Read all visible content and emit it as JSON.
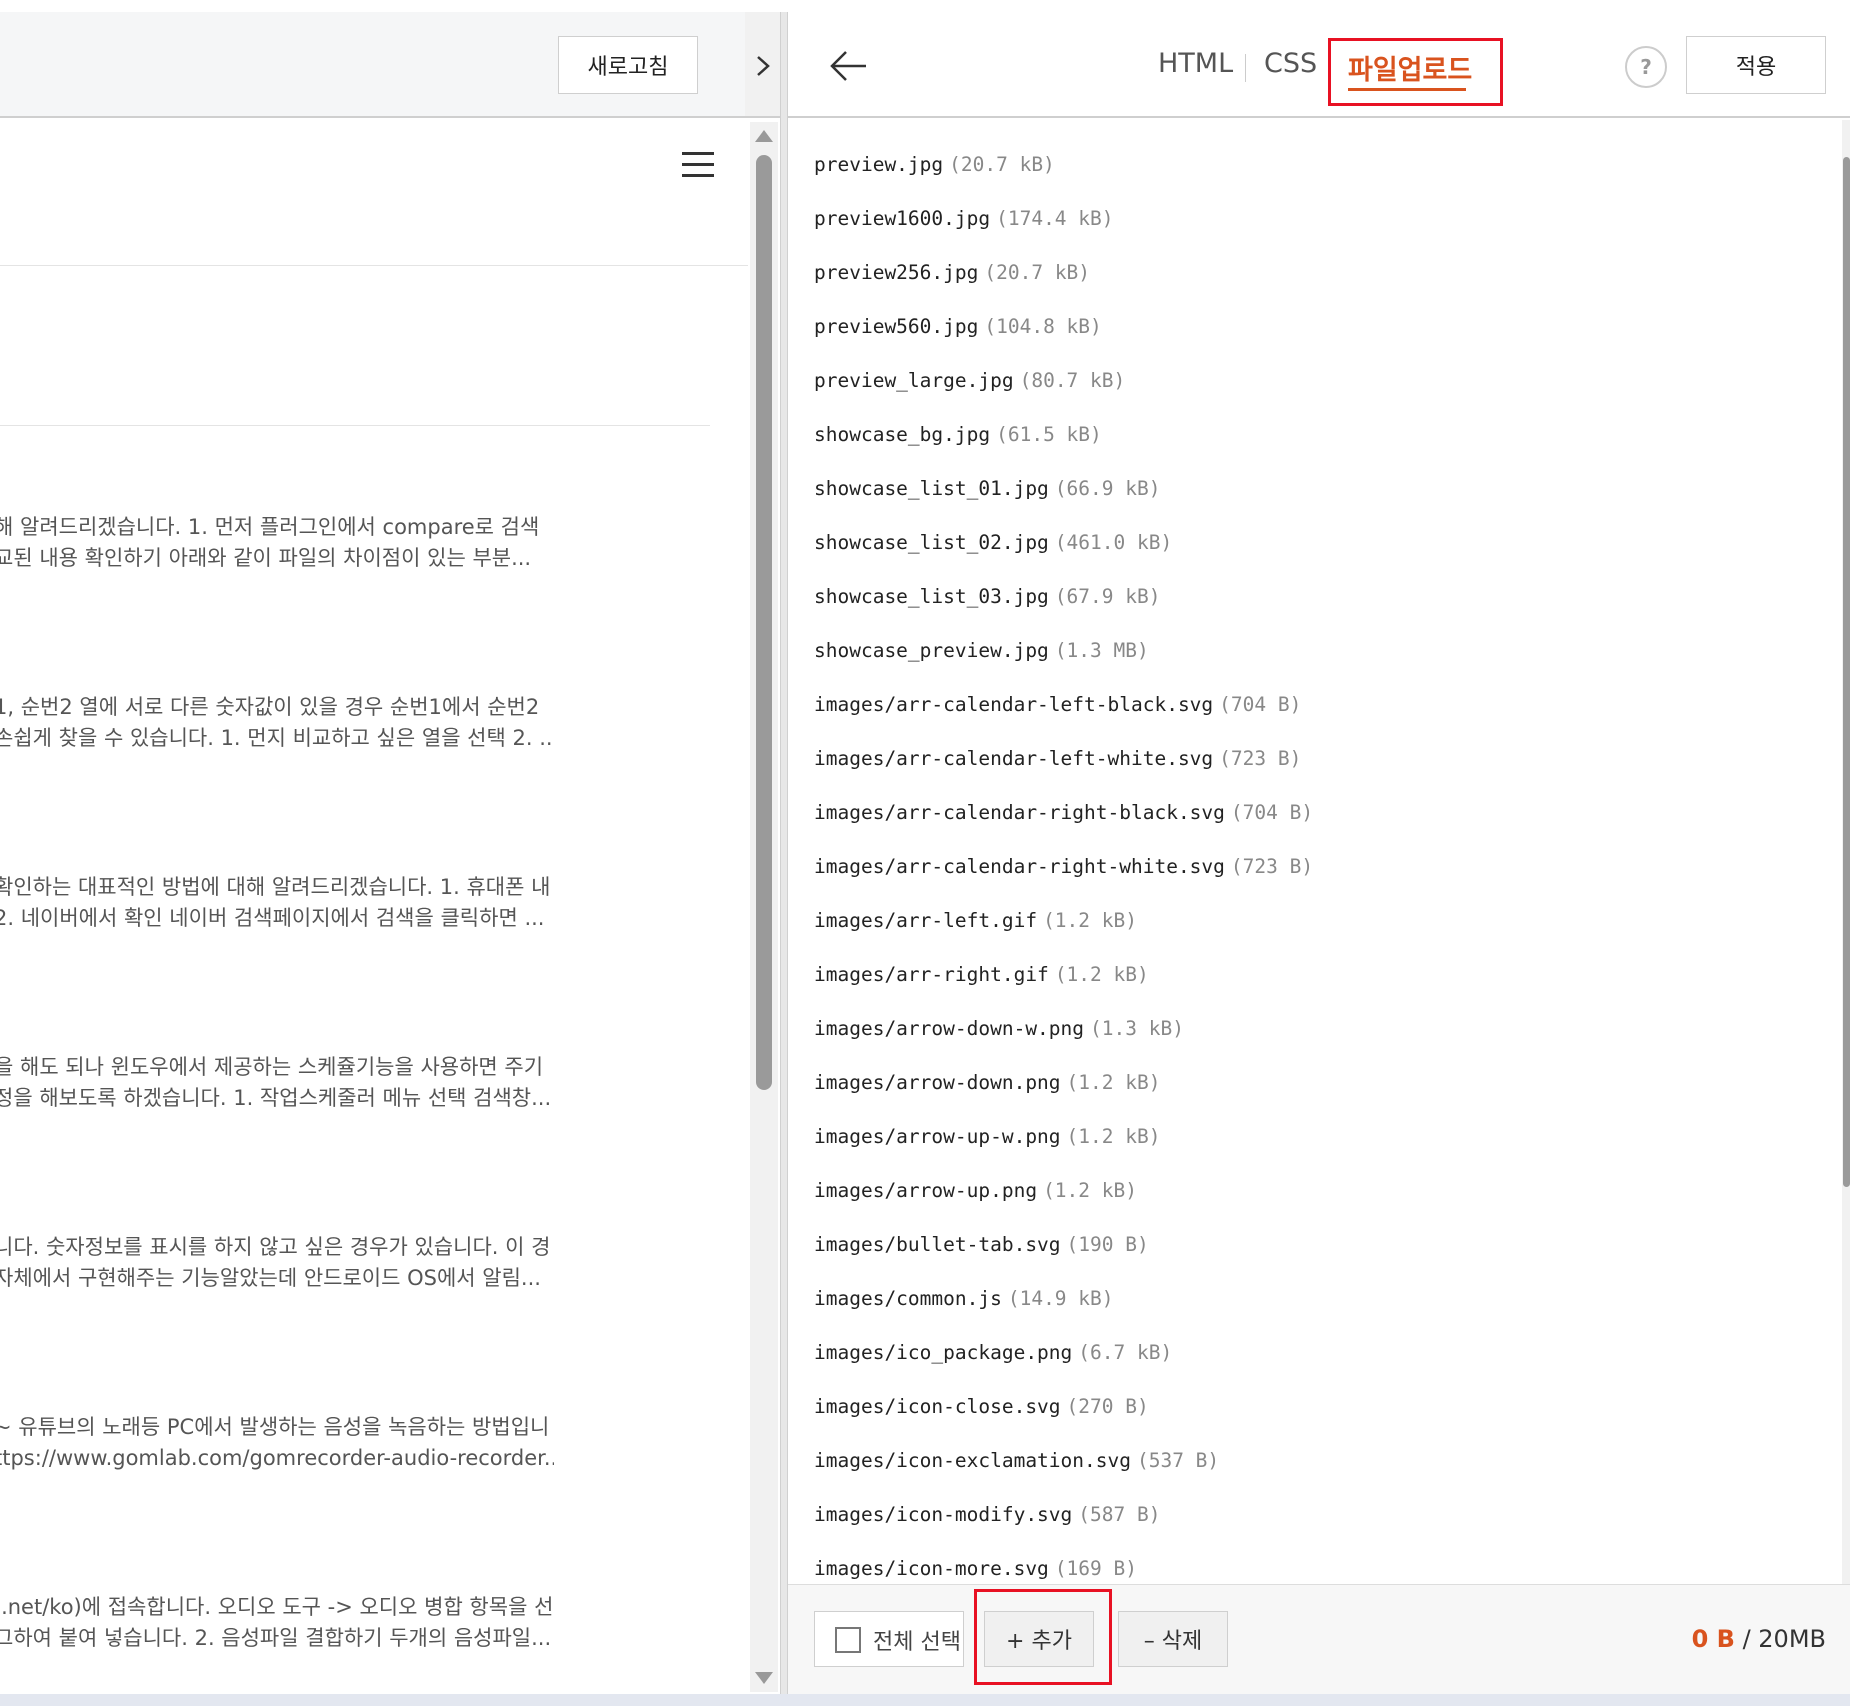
{
  "left": {
    "refresh_label": "새로고침",
    "excerpts": [
      [
        "해 알려드리겠습니다. 1. 먼저 플러그인에서 compare로 검색",
        "교된 내용 확인하기 아래와 같이 파일의 차이점이 있는 부분..."
      ],
      [
        "1, 순번2 열에 서로 다른 숫자값이 있을 경우 순번1에서 순번2",
        "손쉽게 찾을 수 있습니다. 1. 먼지 비교하고 싶은 열을 선택 2. ..."
      ],
      [
        "확인하는 대표적인 방법에 대해 알려드리겠습니다. 1. 휴대폰 내",
        "2. 네이버에서 확인 네이버 검색페이지에서 검색을 클릭하면 ..."
      ],
      [
        "을 해도 되나 윈도우에서 제공하는 스케쥴기능을 사용하면 주기",
        "정을 해보도록 하겠습니다. 1. 작업스케줄러 메뉴 선택 검색창..."
      ],
      [
        "니다. 숫자정보를 표시를 하지 않고 싶은 경우가 있습니다. 이 경",
        "자체에서 구현해주는 기능알았는데 안드로이드 OS에서 알림..."
      ],
      [
        "~ 유튜브의 노래등 PC에서 발생하는 음성을 녹음하는 방법입니",
        "ttps://www.gomlab.com/gomrecorder-audio-recorder..."
      ],
      [
        ":.net/ko)에 접속합니다. 오디오 도구 -> 오디오 병합 항목을 선",
        "그하여 붙여 넣습니다. 2. 음성파일 결합하기 두개의 음성파일..."
      ]
    ]
  },
  "right": {
    "tabs": {
      "html": "HTML",
      "css": "CSS",
      "upload": "파일업로드"
    },
    "help_label": "?",
    "apply_label": "적용",
    "files": [
      {
        "name": "preview.jpg",
        "size": "(20.7 kB)"
      },
      {
        "name": "preview1600.jpg",
        "size": "(174.4 kB)"
      },
      {
        "name": "preview256.jpg",
        "size": "(20.7 kB)"
      },
      {
        "name": "preview560.jpg",
        "size": "(104.8 kB)"
      },
      {
        "name": "preview_large.jpg",
        "size": "(80.7 kB)"
      },
      {
        "name": "showcase_bg.jpg",
        "size": "(61.5 kB)"
      },
      {
        "name": "showcase_list_01.jpg",
        "size": "(66.9 kB)"
      },
      {
        "name": "showcase_list_02.jpg",
        "size": "(461.0 kB)"
      },
      {
        "name": "showcase_list_03.jpg",
        "size": "(67.9 kB)"
      },
      {
        "name": "showcase_preview.jpg",
        "size": "(1.3 MB)"
      },
      {
        "name": "images/arr-calendar-left-black.svg",
        "size": "(704 B)"
      },
      {
        "name": "images/arr-calendar-left-white.svg",
        "size": "(723 B)"
      },
      {
        "name": "images/arr-calendar-right-black.svg",
        "size": "(704 B)"
      },
      {
        "name": "images/arr-calendar-right-white.svg",
        "size": "(723 B)"
      },
      {
        "name": "images/arr-left.gif",
        "size": "(1.2 kB)"
      },
      {
        "name": "images/arr-right.gif",
        "size": "(1.2 kB)"
      },
      {
        "name": "images/arrow-down-w.png",
        "size": "(1.3 kB)"
      },
      {
        "name": "images/arrow-down.png",
        "size": "(1.2 kB)"
      },
      {
        "name": "images/arrow-up-w.png",
        "size": "(1.2 kB)"
      },
      {
        "name": "images/arrow-up.png",
        "size": "(1.2 kB)"
      },
      {
        "name": "images/bullet-tab.svg",
        "size": "(190 B)"
      },
      {
        "name": "images/common.js",
        "size": "(14.9 kB)"
      },
      {
        "name": "images/ico_package.png",
        "size": "(6.7 kB)"
      },
      {
        "name": "images/icon-close.svg",
        "size": "(270 B)"
      },
      {
        "name": "images/icon-exclamation.svg",
        "size": "(537 B)"
      },
      {
        "name": "images/icon-modify.svg",
        "size": "(587 B)"
      },
      {
        "name": "images/icon-more.svg",
        "size": "(169 B)"
      }
    ],
    "footer": {
      "select_all_label": "전체 선택",
      "add_label": "+ 추가",
      "delete_label": "– 삭제",
      "usage_used": "0 B",
      "usage_sep": " / ",
      "usage_total": "20MB"
    }
  },
  "colors": {
    "accent": "#d9531e",
    "highlight_box": "#e81123"
  },
  "icons": [
    "menu-icon",
    "chevron-right-icon",
    "back-arrow-icon",
    "help-icon",
    "scroll-up-icon",
    "scroll-down-icon",
    "checkbox-icon"
  ]
}
